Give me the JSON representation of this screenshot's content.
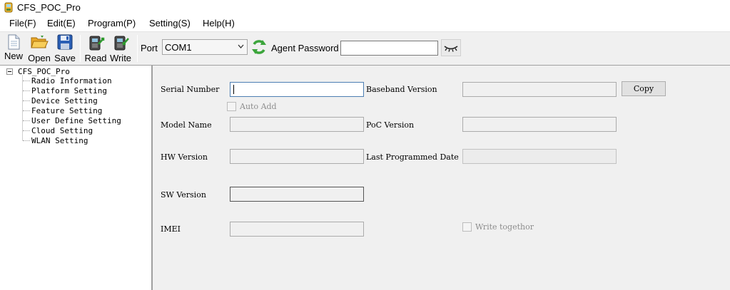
{
  "window": {
    "title": "CFS_POC_Pro",
    "icon": "app-icon"
  },
  "menu": {
    "file": "File(F)",
    "edit": "Edit(E)",
    "program": "Program(P)",
    "setting": "Setting(S)",
    "help": "Help(H)"
  },
  "toolbar": {
    "new": "New",
    "open": "Open",
    "save": "Save",
    "read": "Read",
    "write": "Write",
    "port_label": "Port",
    "port_value": "COM1",
    "agent_password_label": "Agent Password",
    "agent_password_value": ""
  },
  "tree": {
    "root": "CFS_POC_Pro",
    "items": [
      "Radio Information",
      "Platform Setting",
      "Device Setting",
      "Feature Setting",
      "User Define Setting",
      "Cloud Setting",
      "WLAN Setting"
    ]
  },
  "form": {
    "serial_number_label": "Serial Number",
    "serial_number_value": "",
    "auto_add_label": "Auto Add",
    "auto_add_checked": false,
    "model_name_label": "Model Name",
    "model_name_value": "",
    "hw_version_label": "HW Version",
    "hw_version_value": "",
    "sw_version_label": "SW Version",
    "sw_version_value": "",
    "imei_label": "IMEI",
    "imei_value": "",
    "baseband_version_label": "Baseband Version",
    "baseband_version_value": "",
    "copy_button": "Copy",
    "poc_version_label": "PoC Version",
    "poc_version_value": "",
    "last_programmed_date_label": "Last Programmed Date",
    "last_programmed_date_value": "",
    "write_together_label": "Write togethor",
    "write_together_checked": false
  },
  "colors": {
    "focus_border": "#4d7fb3",
    "window_bg": "#f0f0f0",
    "panel_bg": "#ffffff"
  }
}
